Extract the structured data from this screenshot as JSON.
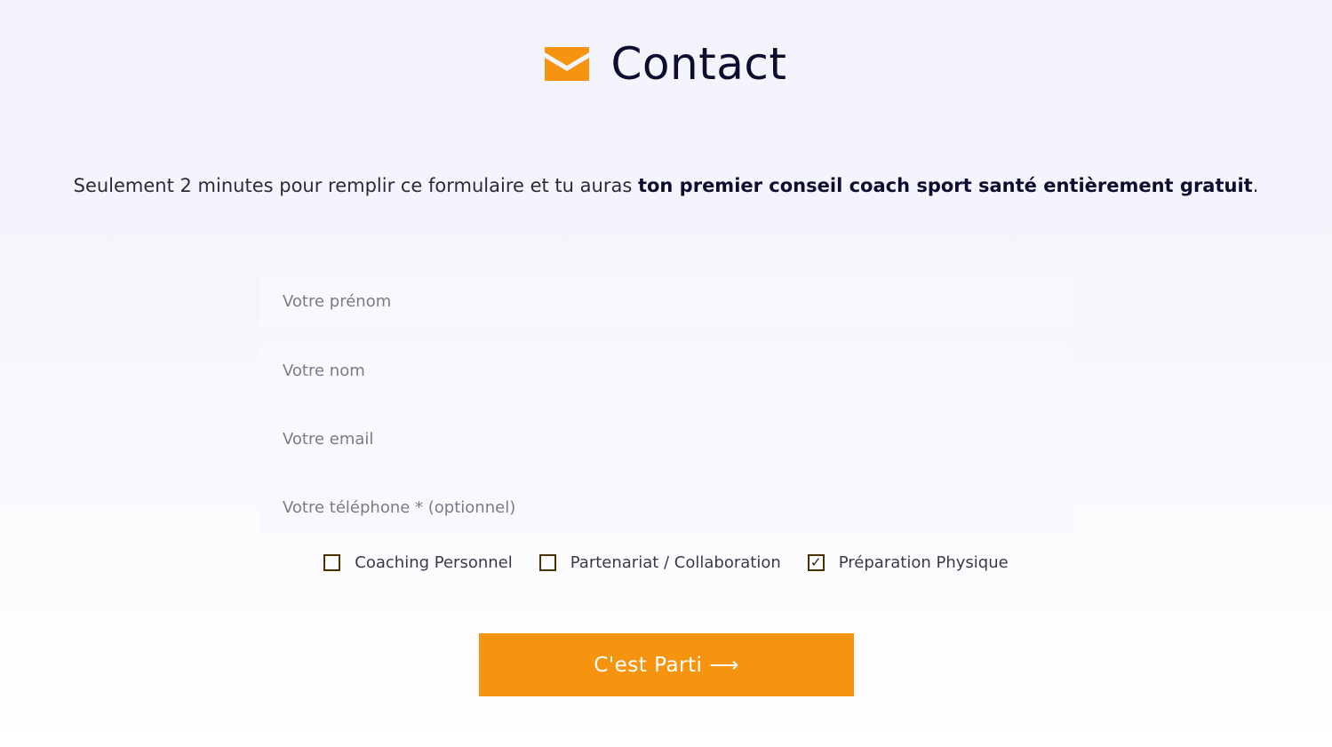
{
  "header": {
    "icon": "mail-icon",
    "title": "Contact",
    "accent_color": "#f7940f"
  },
  "intro": {
    "text_before": "Seulement 2 minutes pour remplir ce formulaire et tu auras ",
    "text_bold": "ton premier conseil coach sport santé entièrement gratuit",
    "text_after": "."
  },
  "form": {
    "fields": [
      {
        "placeholder": "Votre prénom",
        "value": ""
      },
      {
        "placeholder": "Votre nom",
        "value": ""
      },
      {
        "placeholder": "Votre email",
        "value": ""
      },
      {
        "placeholder": "Votre téléphone * (optionnel)",
        "value": ""
      }
    ],
    "options": [
      {
        "label": "Coaching Personnel",
        "checked": false
      },
      {
        "label": "Partenariat / Collaboration",
        "checked": false
      },
      {
        "label": "Préparation Physique",
        "checked": true
      }
    ],
    "check_mark": "✓",
    "submit_label": "C'est Parti ⟶"
  }
}
